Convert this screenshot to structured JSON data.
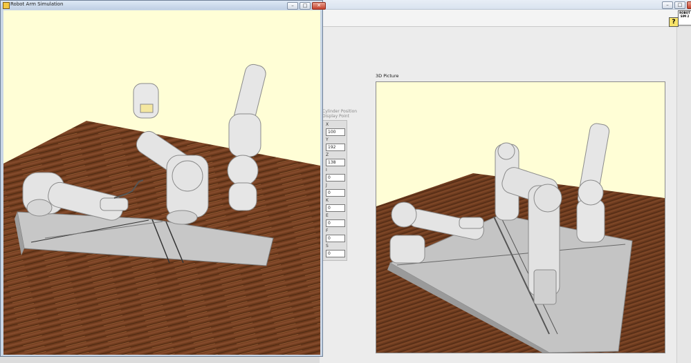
{
  "simulation_window": {
    "title": "Robot Arm Simulation",
    "buttons": {
      "minimize": "–",
      "maximize": "□",
      "close": "✕"
    }
  },
  "main_window": {
    "buttons": {
      "minimize": "–",
      "maximize": "□",
      "close": "✕"
    },
    "help_label": "?",
    "robot_icon_label": "ROBOT SIM 2"
  },
  "controls": {
    "header_line1": "Cylinder Position",
    "header_line2": "Display Point",
    "fields": [
      {
        "label": "X",
        "value": "100"
      },
      {
        "label": "Y",
        "value": "192"
      },
      {
        "label": "Z",
        "value": "138"
      },
      {
        "label": "I",
        "value": "0"
      },
      {
        "label": "J",
        "value": "0"
      },
      {
        "label": "K",
        "value": "0"
      },
      {
        "label": "E",
        "value": "0"
      },
      {
        "label": "F",
        "value": "0"
      },
      {
        "label": "S",
        "value": "0"
      }
    ]
  },
  "picture": {
    "label": "3D Picture"
  },
  "colors": {
    "background": "#fffed6",
    "wood": "#6b3a1e",
    "platform": "#bdbdbd",
    "robot": "#e6e6e6"
  }
}
